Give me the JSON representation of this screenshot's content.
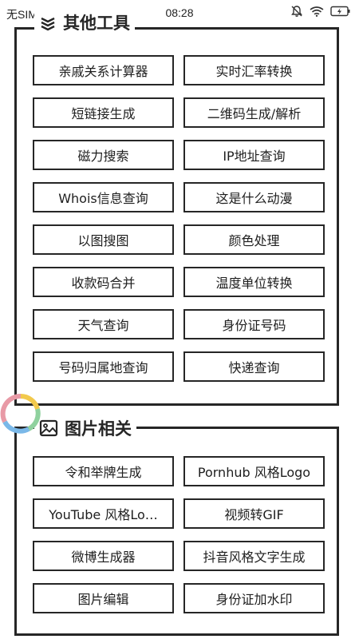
{
  "status_bar": {
    "carrier": "无SIM",
    "time": "08:28"
  },
  "sections": [
    {
      "title": "其他工具",
      "items": [
        "亲戚关系计算器",
        "实时汇率转换",
        "短链接生成",
        "二维码生成/解析",
        "磁力搜索",
        "IP地址查询",
        "Whois信息查询",
        "这是什么动漫",
        "以图搜图",
        "颜色处理",
        "收款码合并",
        "温度单位转换",
        "天气查询",
        "身份证号码",
        "号码归属地查询",
        "快递查询"
      ]
    },
    {
      "title": "图片相关",
      "items": [
        "令和举牌生成",
        "Pornhub 风格Logo",
        "YouTube 风格Lo…",
        "视频转GIF",
        "微博生成器",
        "抖音风格文字生成",
        "图片编辑",
        "身份证加水印"
      ]
    }
  ]
}
